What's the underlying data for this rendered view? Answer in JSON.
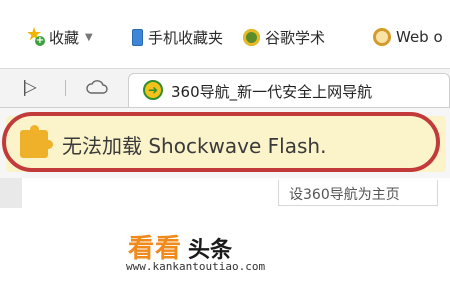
{
  "bookmarks": {
    "favorites_label": "收藏",
    "mobile_favorites_label": "手机收藏夹",
    "google_scholar_label": "谷歌学术",
    "web_label": "Web o"
  },
  "tab": {
    "title": "360导航_新一代安全上网导航"
  },
  "notification": {
    "message": "无法加载 Shockwave Flash."
  },
  "page": {
    "set_homepage_label": "设360导航为主页"
  },
  "watermark": {
    "brand_orange": "看看",
    "brand_black": "头条",
    "url": "www.kankantoutiao.com"
  },
  "colors": {
    "notification_bg": "#fbf3c9",
    "highlight_outline": "#c23a3a",
    "plugin_icon": "#efb12a",
    "brand_orange": "#f08a1c"
  },
  "icons": {
    "favorites": "star-plus-icon",
    "mobile": "phone-icon",
    "scholar": "scholar-icon",
    "web": "web-icon",
    "sidebar": "sidebar-toggle-icon",
    "cloud": "cloud-icon",
    "tab_favicon": "360-favicon-icon",
    "plugin": "plugin-puzzle-icon"
  }
}
